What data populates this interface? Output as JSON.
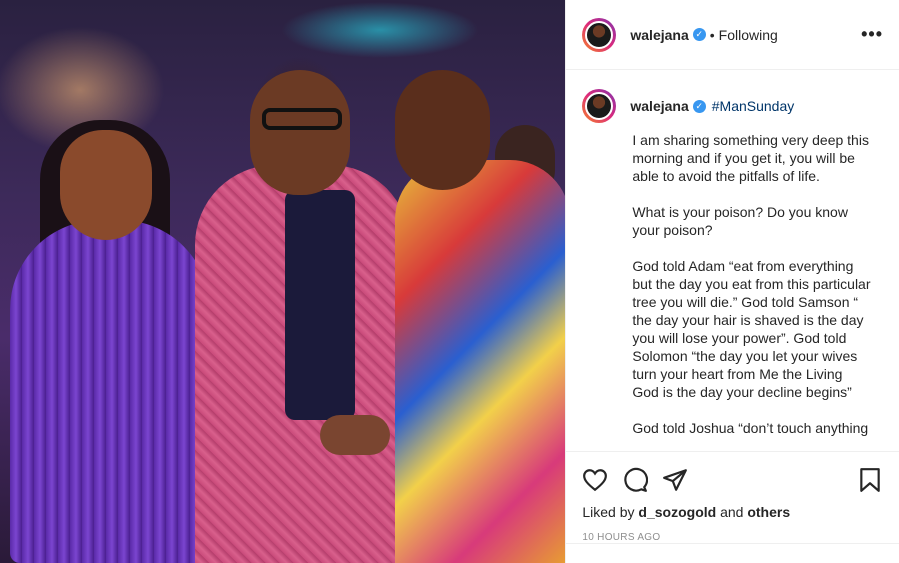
{
  "header": {
    "username": "walejana",
    "separator": "•",
    "follow_status": "Following",
    "more": "•••"
  },
  "caption": {
    "username": "walejana",
    "hashtag": "#ManSunday",
    "paragraphs": [
      "I am sharing something very deep this morning and if you get it, you will be able to avoid the pitfalls of life.",
      "What is your poison? Do you know your poison?",
      "God told Adam “eat from everything but the day you eat from this particular tree you will die.” God told Samson “ the day your hair is shaved is the day you will lose your power”. God told Solomon “the day you let your wives turn your heart from Me the Living God is the day your decline begins”",
      "God told Joshua “don’t touch anything"
    ]
  },
  "likes": {
    "prefix": "Liked by",
    "user": "d_sozogold",
    "joiner": "and",
    "others": "others"
  },
  "timestamp": "10 HOURS AGO",
  "icons": {
    "like": "heart-icon",
    "comment": "comment-icon",
    "share": "share-icon",
    "save": "bookmark-icon",
    "verified": "verified-badge-icon"
  },
  "colors": {
    "verified": "#3897f0",
    "hashtag": "#003569",
    "text": "#262626",
    "muted": "#8e8e8e"
  }
}
